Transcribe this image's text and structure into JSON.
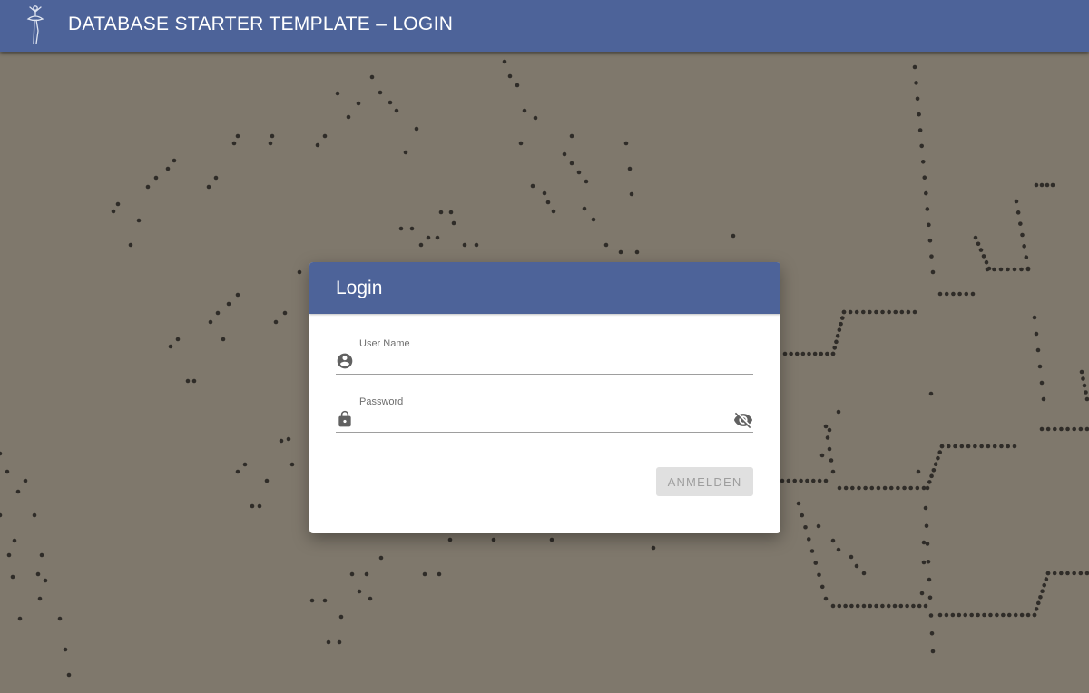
{
  "app": {
    "title": "DATABASE STARTER TEMPLATE – LOGIN",
    "logo_icon": "ballerina-logo-icon"
  },
  "login": {
    "title": "Login",
    "username_label": "User Name",
    "username_value": "",
    "username_icon": "account-circle-icon",
    "password_label": "Password",
    "password_value": "",
    "password_icon": "lock-icon",
    "visibility_icon": "visibility-off-icon",
    "submit_label": "ANMELDEN"
  },
  "colors": {
    "primary": "#4d6399",
    "background": "#7f786c",
    "button_disabled_bg": "#e0e0e0",
    "button_disabled_text": "#9e9e9e"
  }
}
